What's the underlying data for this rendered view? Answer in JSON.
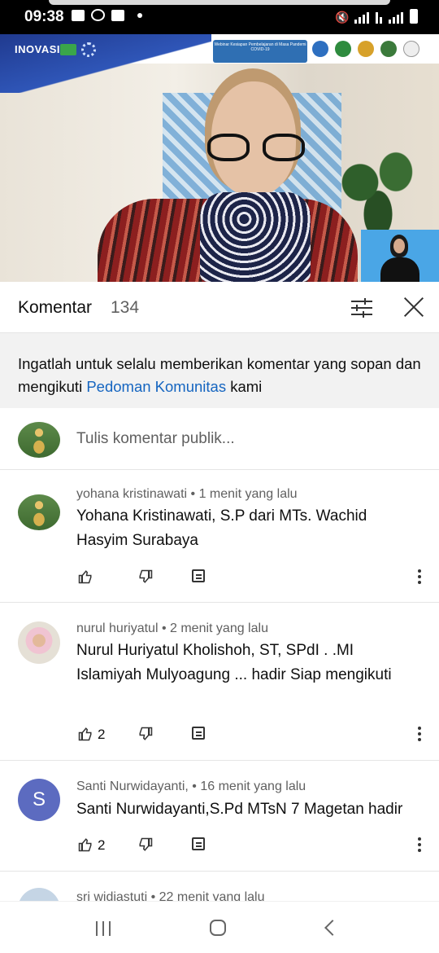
{
  "status_bar": {
    "time": "09:38",
    "left_icons": [
      "gallery-icon",
      "whatsapp-icon",
      "message-icon",
      "dot-icon"
    ],
    "right_icons": [
      "mute-icon",
      "signal-icon",
      "data-icon",
      "signal-icon",
      "battery-icon"
    ]
  },
  "video": {
    "brand": "INOVASI",
    "webinar_text": "Webinar Kesiapan Pembelajaran di Masa Pandemi COVID-19"
  },
  "comments_header": {
    "title": "Komentar",
    "count": "134"
  },
  "guidelines": {
    "text_before": "Ingatlah untuk selalu memberikan komentar yang sopan dan mengikuti ",
    "link": "Pedoman Komunitas",
    "text_after": " kami"
  },
  "add_comment": {
    "placeholder": "Tulis komentar publik..."
  },
  "comments": [
    {
      "author": "yohana kristinawati",
      "time": "1 menit yang lalu",
      "text": "Yohana Kristinawati, S.P dari MTs. Wachid Hasyim Surabaya",
      "likes": ""
    },
    {
      "author": "nurul huriyatul",
      "time": "2 menit yang lalu",
      "text": "Nurul Huriyatul Kholishoh, ST, SPdI . .MI Islamiyah Mulyoagung ... hadir Siap mengikuti",
      "likes": "2"
    },
    {
      "author": "Santi Nurwidayanti,",
      "time": "16 menit yang lalu",
      "text": "Santi Nurwidayanti,S.Pd MTsN 7 Magetan hadir",
      "likes": "2",
      "avatar_letter": "S"
    },
    {
      "author": "sri widiastuti",
      "time": "22 menit yang lalu"
    }
  ],
  "colors": {
    "link": "#1565c0",
    "avatar_s": "#5c6bc0",
    "guidelines_bg": "#f2f2f2"
  }
}
